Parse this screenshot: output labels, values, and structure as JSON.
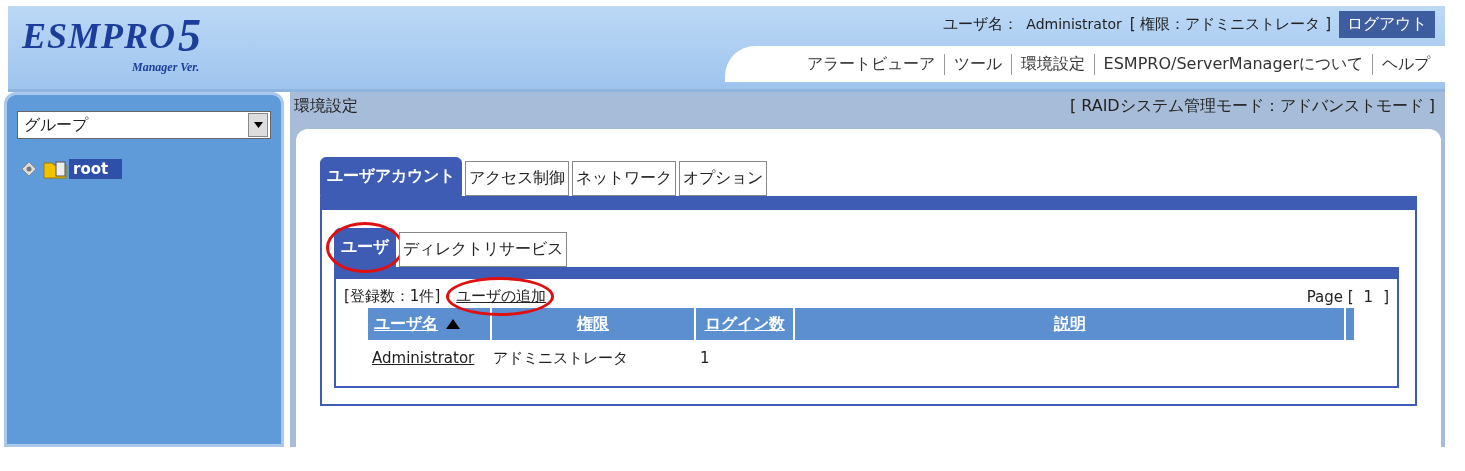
{
  "logo": {
    "name": "ESMPRO",
    "version": "5",
    "subtitle": "Manager Ver."
  },
  "user_bar": {
    "label": "ユーザ名：",
    "user": "Administrator",
    "role": "[ 権限：アドミニストレータ ]",
    "logout": "ログアウト"
  },
  "nav": [
    "アラートビューア",
    "ツール",
    "環境設定",
    "ESMPRO/ServerManagerについて",
    "ヘルプ"
  ],
  "sidebar": {
    "select": "グループ",
    "tree": [
      {
        "label": "root",
        "selected": true
      }
    ]
  },
  "page_title": "環境設定",
  "mode": "[ RAIDシステム管理モード：アドバンストモード ]",
  "tabs": [
    {
      "label": "ユーザアカウント",
      "selected": true
    },
    {
      "label": "アクセス制御",
      "selected": false
    },
    {
      "label": "ネットワーク",
      "selected": false
    },
    {
      "label": "オプション",
      "selected": false
    }
  ],
  "sub_tabs": [
    {
      "label": "ユーザ",
      "selected": true,
      "circled": true
    },
    {
      "label": "ディレクトリサービス",
      "selected": false,
      "circled": false
    }
  ],
  "count": "[登録数：1件]",
  "add_link": {
    "label": "ユーザの追加",
    "circled": true
  },
  "pager": {
    "label": "Page [",
    "page": "1",
    "end": "]"
  },
  "table": {
    "columns": [
      {
        "label": "ユーザ名",
        "sorted": true
      },
      {
        "label": "権限",
        "sorted": false
      },
      {
        "label": "ログイン数",
        "sorted": false
      },
      {
        "label": "説明",
        "sorted": false
      }
    ],
    "rows": [
      [
        "Administrator",
        "アドミニストレータ",
        "1",
        ""
      ]
    ]
  }
}
